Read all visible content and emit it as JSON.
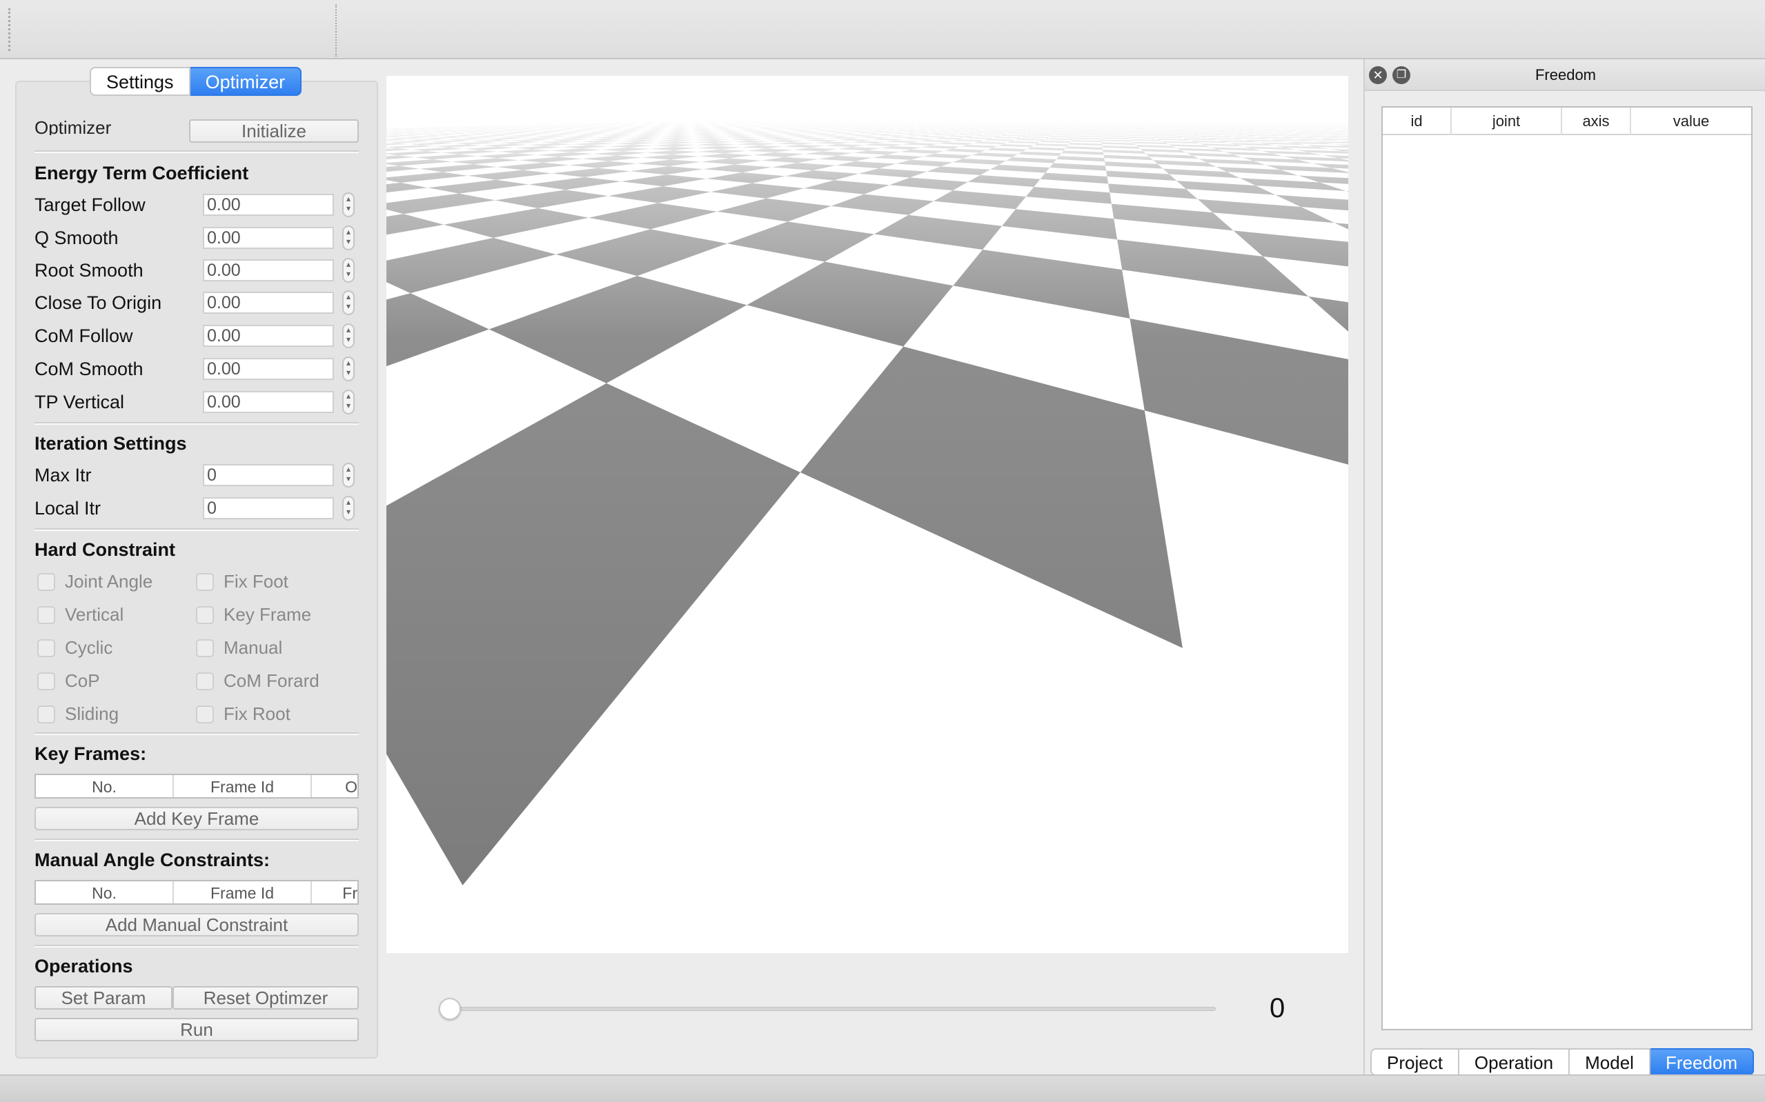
{
  "left_tabs": [
    {
      "label": "Settings",
      "active": false
    },
    {
      "label": "Optimizer",
      "active": true
    }
  ],
  "optimizer_header": {
    "label": "Optimizer",
    "initialize_button": "Initialize"
  },
  "energy": {
    "title": "Energy Term Coefficient",
    "rows": [
      {
        "label": "Target Follow",
        "value": "0.00"
      },
      {
        "label": "Q Smooth",
        "value": "0.00"
      },
      {
        "label": "Root Smooth",
        "value": "0.00"
      },
      {
        "label": "Close To Origin",
        "value": "0.00"
      },
      {
        "label": "CoM Follow",
        "value": "0.00"
      },
      {
        "label": "CoM Smooth",
        "value": "0.00"
      },
      {
        "label": "TP Vertical",
        "value": "0.00"
      }
    ]
  },
  "iteration": {
    "title": "Iteration Settings",
    "rows": [
      {
        "label": "Max Itr",
        "value": "0"
      },
      {
        "label": "Local Itr",
        "value": "0"
      }
    ]
  },
  "hard_constraint": {
    "title": "Hard Constraint",
    "left": [
      "Joint Angle",
      "Vertical",
      "Cyclic",
      "CoP",
      "Sliding"
    ],
    "right": [
      "Fix Foot",
      "Key Frame",
      "Manual",
      "CoM Forard",
      "Fix Root"
    ]
  },
  "key_frames": {
    "title": "Key Frames:",
    "columns": [
      "No.",
      "Frame Id",
      "O"
    ],
    "button": "Add Key Frame"
  },
  "manual_constraints": {
    "title": "Manual Angle Constraints:",
    "columns": [
      "No.",
      "Frame Id",
      "Fr"
    ],
    "button": "Add Manual Constraint"
  },
  "operations": {
    "title": "Operations",
    "set_param": "Set Param",
    "reset": "Reset Optimzer",
    "run": "Run"
  },
  "timeline": {
    "value": "0",
    "position": 0
  },
  "dock": {
    "title": "Freedom",
    "columns": [
      "id",
      "joint",
      "axis",
      "value"
    ],
    "tabs": [
      {
        "label": "Project",
        "active": false
      },
      {
        "label": "Operation",
        "active": false
      },
      {
        "label": "Model",
        "active": false
      },
      {
        "label": "Freedom",
        "active": true
      }
    ]
  },
  "colors": {
    "accent": "#2f7ff0",
    "floor_dark": "#7a7a7a",
    "floor_light": "#ffffff"
  }
}
